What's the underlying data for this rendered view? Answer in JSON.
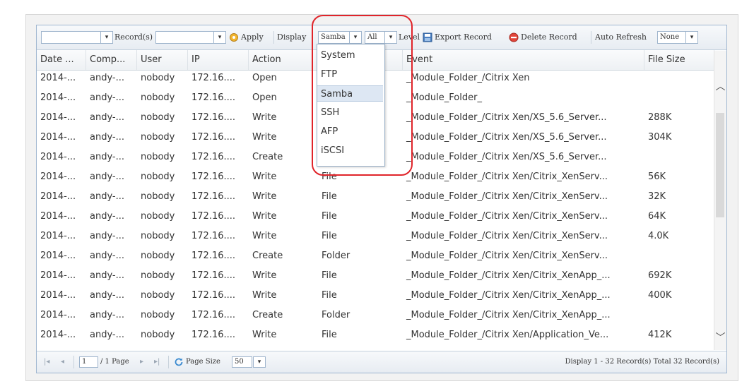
{
  "toolbar": {
    "record_label": "Record(s)",
    "apply_label": "Apply",
    "display_label": "Display",
    "display_value": "Samba",
    "level_value": "All",
    "level_label": "Level",
    "export_label": "Export Record",
    "delete_label": "Delete Record",
    "auto_refresh_label": "Auto Refresh",
    "auto_refresh_value": "None",
    "arrow_glyph": "▾"
  },
  "columns": [
    "Date ...",
    "Comp...",
    "User",
    "IP",
    "Action",
    "",
    "Event",
    "File Size"
  ],
  "rows": [
    [
      "2014-...",
      "andy-...",
      "nobody",
      "172.16....",
      "Open",
      "",
      "_Module_Folder_/Citrix Xen",
      ""
    ],
    [
      "2014-...",
      "andy-...",
      "nobody",
      "172.16....",
      "Open",
      "",
      "_Module_Folder_",
      ""
    ],
    [
      "2014-...",
      "andy-...",
      "nobody",
      "172.16....",
      "Write",
      "",
      "_Module_Folder_/Citrix Xen/XS_5.6_Server...",
      "288K"
    ],
    [
      "2014-...",
      "andy-...",
      "nobody",
      "172.16....",
      "Write",
      "",
      "_Module_Folder_/Citrix Xen/XS_5.6_Server...",
      "304K"
    ],
    [
      "2014-...",
      "andy-...",
      "nobody",
      "172.16....",
      "Create",
      "",
      "_Module_Folder_/Citrix Xen/XS_5.6_Server...",
      ""
    ],
    [
      "2014-...",
      "andy-...",
      "nobody",
      "172.16....",
      "Write",
      "File",
      "_Module_Folder_/Citrix Xen/Citrix_XenServ...",
      "56K"
    ],
    [
      "2014-...",
      "andy-...",
      "nobody",
      "172.16....",
      "Write",
      "File",
      "_Module_Folder_/Citrix Xen/Citrix_XenServ...",
      "32K"
    ],
    [
      "2014-...",
      "andy-...",
      "nobody",
      "172.16....",
      "Write",
      "File",
      "_Module_Folder_/Citrix Xen/Citrix_XenServ...",
      "64K"
    ],
    [
      "2014-...",
      "andy-...",
      "nobody",
      "172.16....",
      "Write",
      "File",
      "_Module_Folder_/Citrix Xen/Citrix_XenServ...",
      "4.0K"
    ],
    [
      "2014-...",
      "andy-...",
      "nobody",
      "172.16....",
      "Create",
      "Folder",
      "_Module_Folder_/Citrix Xen/Citrix_XenServ...",
      ""
    ],
    [
      "2014-...",
      "andy-...",
      "nobody",
      "172.16....",
      "Write",
      "File",
      "_Module_Folder_/Citrix Xen/Citrix_XenApp_...",
      "692K"
    ],
    [
      "2014-...",
      "andy-...",
      "nobody",
      "172.16....",
      "Write",
      "File",
      "_Module_Folder_/Citrix Xen/Citrix_XenApp_...",
      "400K"
    ],
    [
      "2014-...",
      "andy-...",
      "nobody",
      "172.16....",
      "Create",
      "Folder",
      "_Module_Folder_/Citrix Xen/Citrix_XenApp_...",
      ""
    ],
    [
      "2014-...",
      "andy-...",
      "nobody",
      "172.16....",
      "Write",
      "File",
      "_Module_Folder_/Citrix Xen/Application_Ve...",
      "412K"
    ]
  ],
  "dropdown_options": [
    "System",
    "FTP",
    "Samba",
    "SSH",
    "AFP",
    "iSCSI"
  ],
  "dropdown_selected_index": 2,
  "pager": {
    "page_value": "1",
    "page_of": "/ 1 Page",
    "page_size_label": "Page Size",
    "page_size_value": "50",
    "display_text": "Display 1 - 32 Record(s) Total 32 Record(s)",
    "first_glyph": "|◂",
    "prev_glyph": "◂",
    "next_glyph": "▸",
    "last_glyph": "▸|"
  },
  "colors": {
    "highlight": "#e0242a",
    "selected_row": "#dde7f3",
    "border": "#9fb6d0"
  }
}
